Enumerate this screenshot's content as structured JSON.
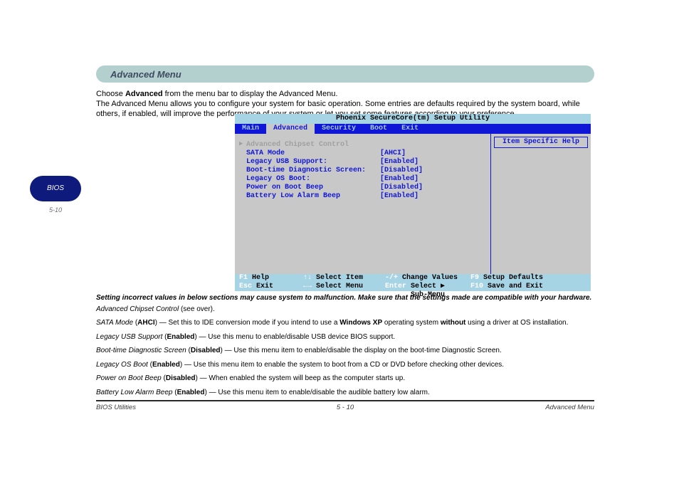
{
  "page": {
    "header": "Advanced Menu",
    "intro_html": "Choose <b>Advanced</b> from the menu bar to display the Advanced Menu.\nThe Advanced Menu allows you to configure your system for basic operation. Some entries are defaults required by the system board, while others, if enabled, will improve the performance of your system or let you set some features according to your preference.",
    "side_badge": "BIOS",
    "side_num": "5-10"
  },
  "bios": {
    "title": "Phoenix SecureCore(tm) Setup Utility",
    "tabs": [
      "Main",
      "Advanced",
      "Security",
      "Boot",
      "Exit"
    ],
    "active_tab": "Advanced",
    "help_title": "Item Specific Help",
    "options": [
      {
        "label": "Advanced Chipset Control",
        "value": "",
        "dim": true
      },
      {
        "label": "SATA Mode",
        "value": "[AHCI]"
      },
      {
        "label": "Legacy USB Support:",
        "value": "[Enabled]"
      },
      {
        "label": "Boot-time Diagnostic Screen:",
        "value": "[Disabled]"
      },
      {
        "label": "Legacy OS Boot:",
        "value": "[Enabled]"
      },
      {
        "label": "Power on Boot Beep",
        "value": "[Disabled]"
      },
      {
        "label": "Battery Low Alarm Beep",
        "value": "[Enabled]"
      }
    ],
    "footer": [
      [
        {
          "key": "F1",
          "desc": "Help"
        },
        {
          "key": "↑↓",
          "desc": "Select Item"
        },
        {
          "key": "-/+",
          "desc": "Change Values"
        },
        {
          "key": "F9",
          "desc": "Setup Defaults"
        }
      ],
      [
        {
          "key": "Esc",
          "desc": "Exit"
        },
        {
          "key": "←→",
          "desc": "Select Menu"
        },
        {
          "key": "Enter",
          "desc": "Select ▶ Sub-Menu"
        },
        {
          "key": "F10",
          "desc": "Save and Exit"
        }
      ]
    ]
  },
  "notes": {
    "hdr": "Setting incorrect values in below sections may cause system to malfunction. Make sure that the settings made are compatible with your hardware.",
    "paragraphs": [
      "<i>Advanced Chipset Control</i> (see over).",
      "<i>SATA Mode</i> (<b>AHCI</b>) — Set this to IDE conversion mode if you intend to use a <b>Windows XP</b> operating system <b>without</b> using a driver at OS installation.",
      "<i>Legacy USB Support</i> (<b>Enabled</b>) — Use this menu to enable/disable USB device BIOS support.",
      "<i>Boot-time Diagnostic Screen</i> (<b>Disabled</b>) — Use this menu item to enable/disable the display on the boot-time Diagnostic Screen.",
      "<i>Legacy OS Boot</i> (<b>Enabled</b>) — Use this menu item to enable the system to boot from a CD or DVD before checking other devices.",
      "<i>Power on Boot Beep</i> (<b>Disabled</b>) — When enabled the system will beep as the computer starts up.",
      "<i>Battery Low Alarm Beep</i> (<b>Enabled</b>) — Use this menu item to enable/disable the audible battery low alarm."
    ]
  },
  "footer": {
    "left": "BIOS Utilities",
    "center": "5 - 10",
    "right": "Advanced Menu"
  }
}
